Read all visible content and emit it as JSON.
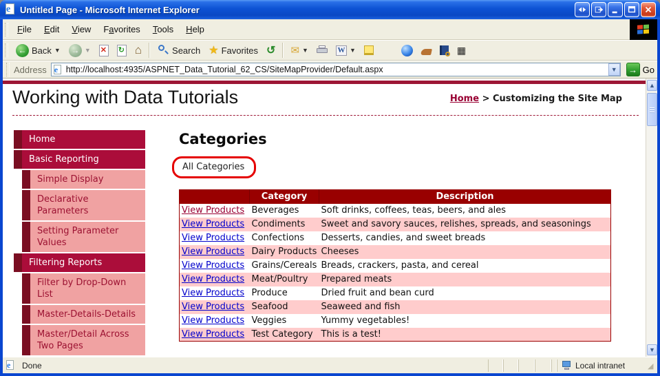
{
  "window": {
    "title": "Untitled Page - Microsoft Internet Explorer"
  },
  "menu": {
    "items": [
      {
        "label": "File",
        "accel": 0
      },
      {
        "label": "Edit",
        "accel": 0
      },
      {
        "label": "View",
        "accel": 0
      },
      {
        "label": "Favorites",
        "accel": 1
      },
      {
        "label": "Tools",
        "accel": 0
      },
      {
        "label": "Help",
        "accel": 0
      }
    ]
  },
  "toolbar": {
    "back_label": "Back",
    "search_label": "Search",
    "favorites_label": "Favorites"
  },
  "address": {
    "label": "Address",
    "url": "http://localhost:4935/ASPNET_Data_Tutorial_62_CS/SiteMapProvider/Default.aspx",
    "go_label": "Go"
  },
  "page": {
    "title": "Working with Data Tutorials",
    "breadcrumb": {
      "home": "Home",
      "separator": ">",
      "current": "Customizing the Site Map"
    },
    "sidebar": {
      "items": [
        {
          "label": "Home",
          "type": "primary"
        },
        {
          "label": "Basic Reporting",
          "type": "primary"
        },
        {
          "label": "Simple Display",
          "type": "secondary"
        },
        {
          "label": "Declarative Parameters",
          "type": "secondary"
        },
        {
          "label": "Setting Parameter Values",
          "type": "secondary"
        },
        {
          "label": "Filtering Reports",
          "type": "primary"
        },
        {
          "label": "Filter by Drop-Down List",
          "type": "secondary"
        },
        {
          "label": "Master-Details-Details",
          "type": "secondary"
        },
        {
          "label": "Master/Detail Across Two Pages",
          "type": "secondary"
        }
      ]
    },
    "main": {
      "heading": "Categories",
      "filter_label": "All Categories",
      "table": {
        "headers": [
          "",
          "Category",
          "Description"
        ],
        "link_label": "View Products",
        "rows": [
          {
            "category": "Beverages",
            "description": "Soft drinks, coffees, teas, beers, and ales",
            "visited": true
          },
          {
            "category": "Condiments",
            "description": "Sweet and savory sauces, relishes, spreads, and seasonings",
            "visited": false
          },
          {
            "category": "Confections",
            "description": "Desserts, candies, and sweet breads",
            "visited": false
          },
          {
            "category": "Dairy Products",
            "description": "Cheeses",
            "visited": false
          },
          {
            "category": "Grains/Cereals",
            "description": "Breads, crackers, pasta, and cereal",
            "visited": false
          },
          {
            "category": "Meat/Poultry",
            "description": "Prepared meats",
            "visited": false
          },
          {
            "category": "Produce",
            "description": "Dried fruit and bean curd",
            "visited": false
          },
          {
            "category": "Seafood",
            "description": "Seaweed and fish",
            "visited": false
          },
          {
            "category": "Veggies",
            "description": "Yummy vegetables!",
            "visited": false
          },
          {
            "category": "Test Category",
            "description": "This is a test!",
            "visited": false
          }
        ]
      }
    }
  },
  "statusbar": {
    "status": "Done",
    "zone": "Local intranet"
  },
  "icons": {
    "back": "←",
    "forward": "→",
    "stop": "✕",
    "refresh": "↻",
    "home": "⌂",
    "favorites_star": "★",
    "history": "↺",
    "mail": "✉",
    "word": "W",
    "barcode": "▦",
    "caret": "▼",
    "combo_arrow": "▼",
    "scroll_up": "▲",
    "scroll_down": "▼",
    "go_arrow": "→",
    "grip_corner": "◢"
  },
  "colors": {
    "titlebar_blue": "#0d52d4",
    "window_border": "#0a46d0",
    "chrome_beige": "#f0eee1",
    "accent_crimson": "#9d1635",
    "nav_dark": "#ab0d3a",
    "nav_strip": "#7a0e22",
    "nav_pink": "#f0a2a2",
    "nav_pink_text": "#9c1232",
    "table_header": "#990000",
    "row_pink": "#ffcccc",
    "link_blue": "#0000cc",
    "link_visited": "#990033",
    "annotation_red": "#e50000",
    "go_green": "#2f9e2f"
  }
}
